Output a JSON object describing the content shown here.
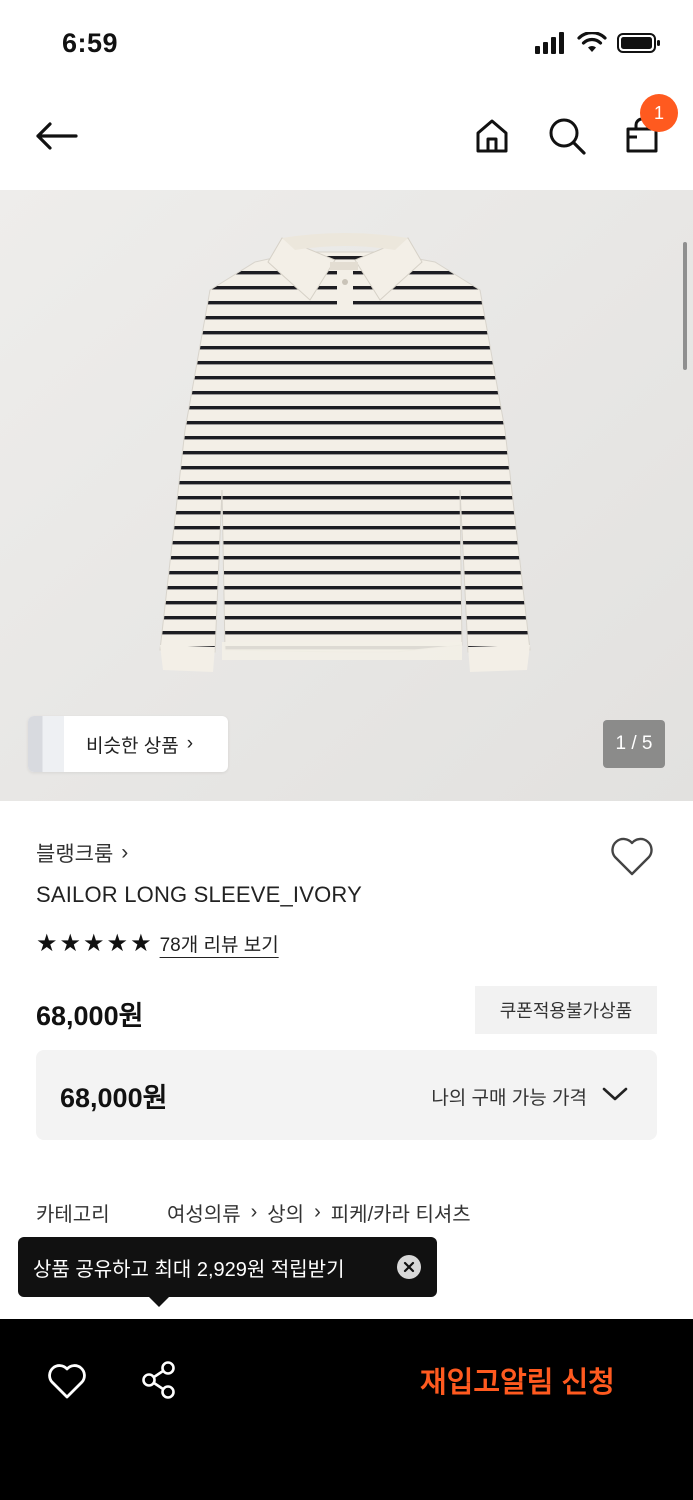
{
  "status_bar": {
    "time": "6:59"
  },
  "header": {
    "back_icon": "arrow-left-icon",
    "home_icon": "home-icon",
    "search_icon": "search-icon",
    "bag_icon": "shopping-bag-icon",
    "cart_count": "1"
  },
  "gallery": {
    "similar_label": "비슷한 상품",
    "similar_chevron": "›",
    "page_indicator": "1 / 5"
  },
  "product": {
    "brand": "블랭크룸",
    "brand_chevron": "›",
    "name": "SAILOR LONG SLEEVE_IVORY",
    "rating": 5,
    "review_link": "78개 리뷰 보기",
    "price": "68,000원",
    "coupon_badge": "쿠폰적용불가상품",
    "my_price": "68,000원",
    "my_price_label": "나의 구매 가능 가격"
  },
  "category": {
    "title": "카테고리",
    "crumbs": [
      "여성의류",
      "상의",
      "피케/카라 티셔츠"
    ]
  },
  "tooltip": {
    "text": "상품 공유하고 최대 2,929원 적립받기"
  },
  "bottom_bar": {
    "restock_label": "재입고알림 신청"
  },
  "colors": {
    "accent": "#ff5a1f",
    "image_bg": "#e9e8e6",
    "bottom_bar_bg": "#000000"
  }
}
